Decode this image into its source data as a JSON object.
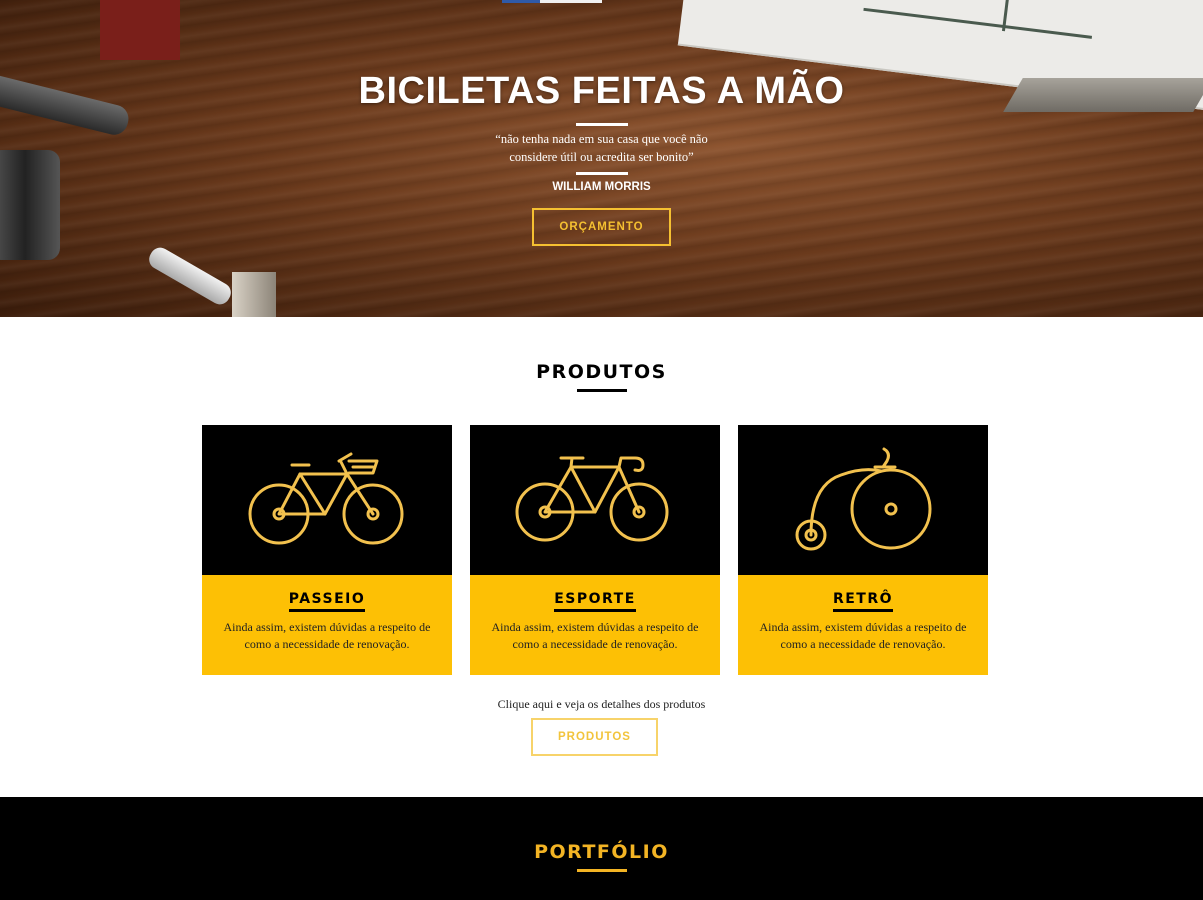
{
  "hero": {
    "title": "BICILETAS FEITAS A MÃO",
    "quote": "“não tenha nada em sua casa que você não considere útil ou acredita ser bonito”",
    "author": "WILLIAM MORRIS",
    "button_label": "ORÇAMENTO"
  },
  "produtos": {
    "title": "PRODUTOS",
    "cards": [
      {
        "title": "PASSEIO",
        "description": "Ainda assim, existem dúvidas a respeito de como a necessidade de renovação.",
        "icon": "city-bike-icon"
      },
      {
        "title": "ESPORTE",
        "description": "Ainda assim, existem dúvidas a respeito de como a necessidade de renovação.",
        "icon": "road-bike-icon"
      },
      {
        "title": "RETRÔ",
        "description": "Ainda assim, existem dúvidas a respeito de como a necessidade de renovação.",
        "icon": "penny-farthing-icon"
      }
    ],
    "note": "Clique aqui e veja os detalhes dos produtos",
    "button_label": "PRODUTOS"
  },
  "portfolio": {
    "title": "PORTFÓLIO"
  },
  "colors": {
    "accent": "#fdc005",
    "icon_stroke": "#f2c14e",
    "portfolio_title": "#f3b424",
    "dark": "#000000"
  }
}
